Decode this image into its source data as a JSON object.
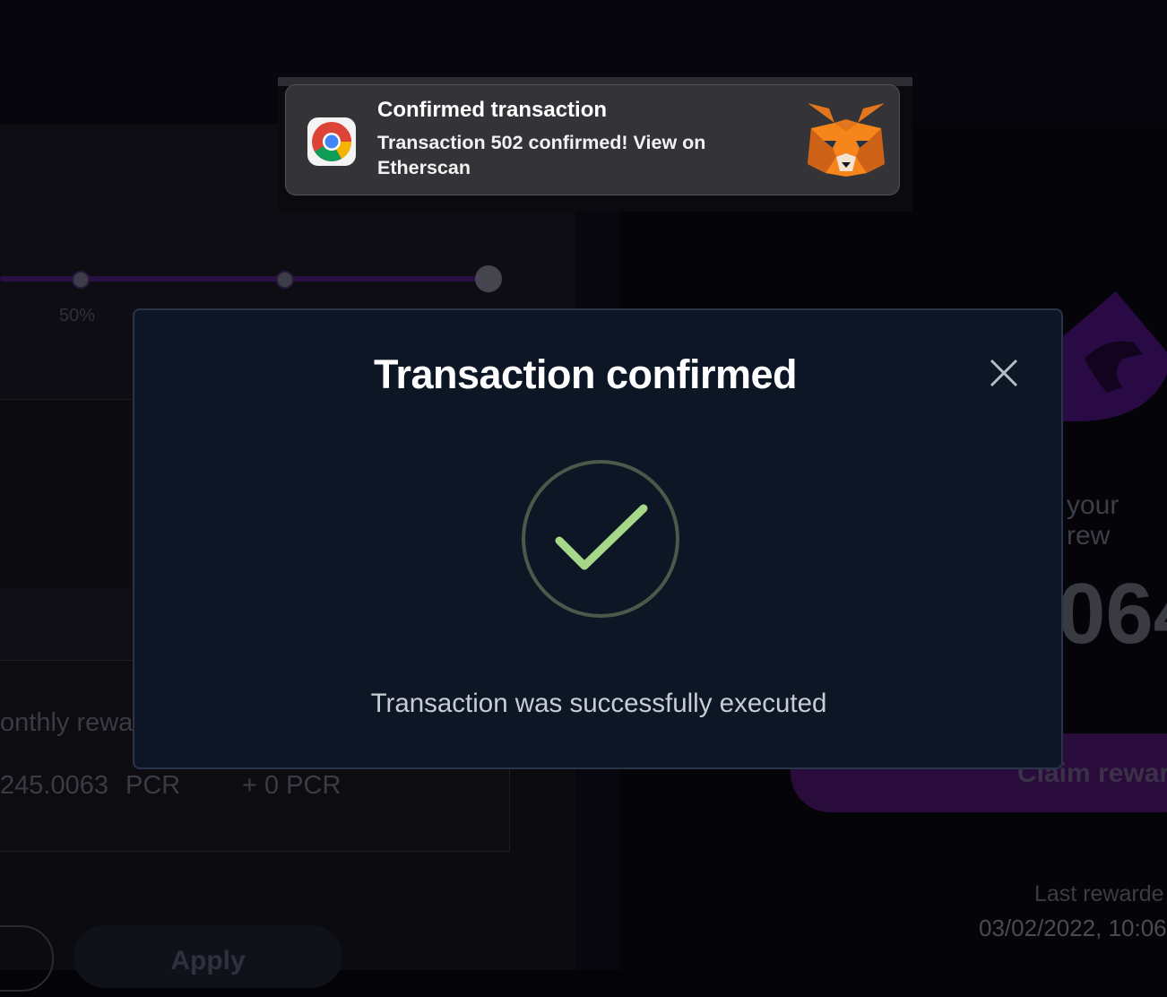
{
  "background": {
    "slider_label": "50%",
    "monthly_label": "onthly rewa",
    "monthly_value": "245.0063",
    "monthly_unit": "PCR",
    "delta_value": "+ 0 PCR",
    "rewards_heading": "your rew",
    "rewards_amount": "064",
    "claim_button": "Claim rewar",
    "apply_button": "Apply",
    "last_rewarded_label": "Last rewarde",
    "last_rewarded_date": "03/02/2022, 10:06"
  },
  "notification": {
    "title": "Confirmed transaction",
    "body": "Transaction 502 confirmed! View on Etherscan",
    "app_icon": "chrome-icon",
    "image_icon": "metamask-fox-icon"
  },
  "modal": {
    "title": "Transaction confirmed",
    "close_icon": "close-icon",
    "status_icon": "check-circle-icon",
    "message": "Transaction was successfully executed",
    "accent_color": "#a6d88a"
  }
}
